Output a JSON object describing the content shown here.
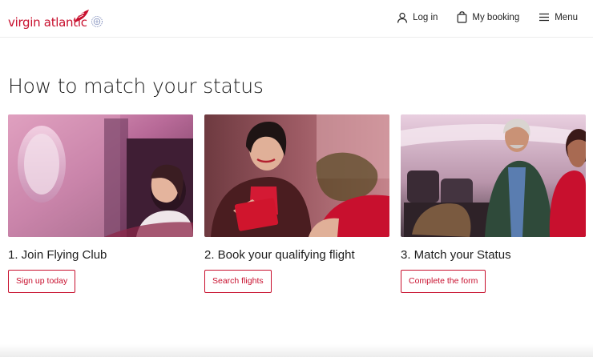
{
  "header": {
    "logo_text": "virgin atlantic",
    "nav": {
      "login_label": "Log in",
      "booking_label": "My booking",
      "menu_label": "Menu"
    }
  },
  "main": {
    "title": "How to match your status",
    "cards": [
      {
        "title": "1. Join Flying Club",
        "button_label": "Sign up today",
        "image": "woman-window-seat-photo"
      },
      {
        "title": "2. Book your qualifying flight",
        "button_label": "Search flights",
        "image": "woman-boarding-pass-photo"
      },
      {
        "title": "3. Match your Status",
        "button_label": "Complete the form",
        "image": "man-aisle-cabin-photo"
      }
    ]
  },
  "colors": {
    "brand_red": "#c8102e",
    "text": "#1d1d1d",
    "header_border": "#ececec"
  }
}
